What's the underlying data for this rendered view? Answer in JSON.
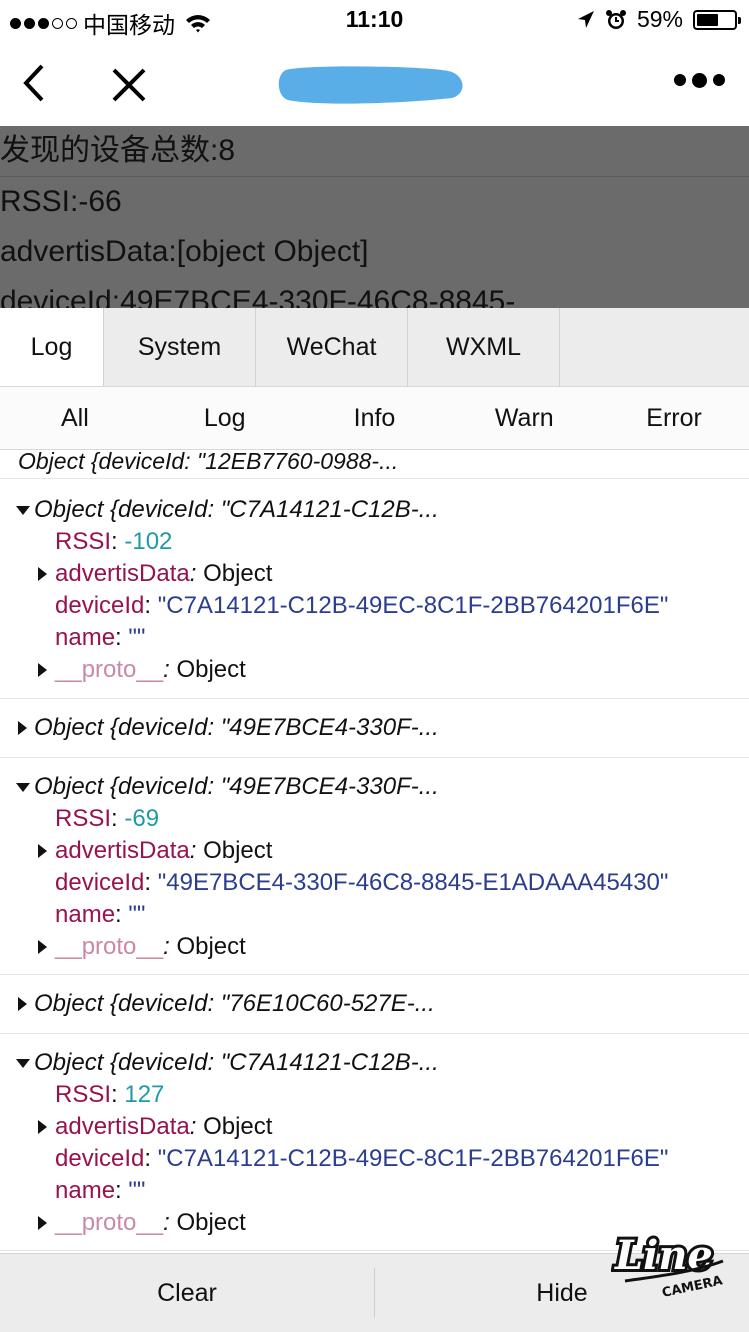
{
  "status_bar": {
    "carrier": "中国移动",
    "time": "11:10",
    "battery": "59%",
    "battery_level": 0.59
  },
  "nav": {
    "back_icon": "chevron-left-icon",
    "close_icon": "close-icon",
    "more_icon": "more-dots-icon"
  },
  "page": {
    "lines": [
      "发现的设备总数:8",
      "RSSI:-66",
      "advertisData:[object Object]",
      "deviceId:49E7BCE4-330F-46C8-8845-"
    ]
  },
  "console": {
    "tabs": [
      "Log",
      "System",
      "WeChat",
      "WXML"
    ],
    "subtabs": [
      "All",
      "Log",
      "Info",
      "Warn",
      "Error"
    ],
    "cut_entry": "Object {deviceId: \"12EB7760-0988-...",
    "entries": [
      {
        "head": "Object {deviceId: \"C7A14121-C12B-...",
        "rssi_key": "RSSI",
        "rssi": "-102",
        "advert_key": "advertisData",
        "advert_val": "Object",
        "deviceid_key": "deviceId",
        "deviceid": "\"C7A14121-C12B-49EC-8C1F-2BB764201F6E\"",
        "name_key": "name",
        "name": "\"\"",
        "proto_key": "__proto__",
        "proto_val": "Object"
      },
      {
        "head": "Object {deviceId: \"49E7BCE4-330F-..."
      },
      {
        "head": "Object {deviceId: \"49E7BCE4-330F-...",
        "rssi_key": "RSSI",
        "rssi": "-69",
        "advert_key": "advertisData",
        "advert_val": "Object",
        "deviceid_key": "deviceId",
        "deviceid": "\"49E7BCE4-330F-46C8-8845-E1ADAAA45430\"",
        "name_key": "name",
        "name": "\"\"",
        "proto_key": "__proto__",
        "proto_val": "Object"
      },
      {
        "head": "Object {deviceId: \"76E10C60-527E-..."
      },
      {
        "head": "Object {deviceId: \"C7A14121-C12B-...",
        "rssi_key": "RSSI",
        "rssi": "127",
        "advert_key": "advertisData",
        "advert_val": "Object",
        "deviceid_key": "deviceId",
        "deviceid": "\"C7A14121-C12B-49EC-8C1F-2BB764201F6E\"",
        "name_key": "name",
        "name": "\"\"",
        "proto_key": "__proto__",
        "proto_val": "Object"
      }
    ],
    "footer": {
      "clear": "Clear",
      "hide": "Hide"
    }
  },
  "watermark": {
    "line1": "Line",
    "line2": "CAMERA"
  }
}
